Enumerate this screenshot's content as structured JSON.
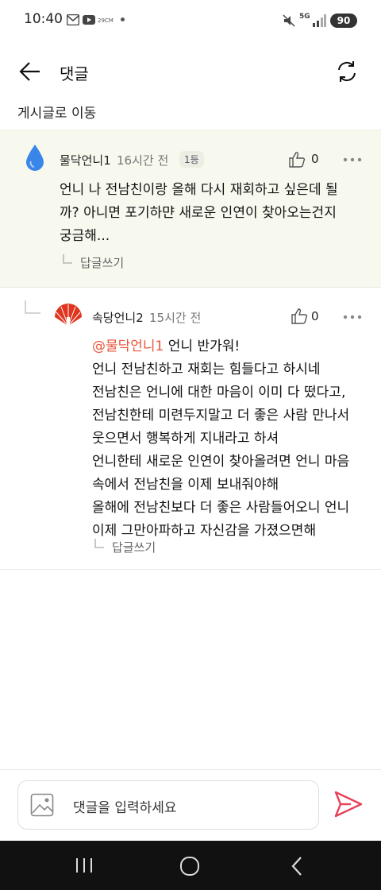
{
  "status_bar": {
    "time": "10:40",
    "mini_label": "29CM",
    "network": "5G",
    "battery": "90"
  },
  "header": {
    "title": "댓글",
    "back_icon": "arrow-left-icon",
    "refresh_icon": "refresh-icon"
  },
  "goto_post": "게시글로 이동",
  "comments": [
    {
      "author": "물닥언니1",
      "time": "16시간 전",
      "badge": "1등",
      "likes": "0",
      "text_lines": [
        "언니 나 전남친이랑 올해 다시 재회하고 싶은데 될",
        "까? 아니면 포기하먄 새로운 인연이 찾아오는건지",
        "궁금해..."
      ],
      "reply_label": "답글쓰기"
    },
    {
      "author": "속당언니2",
      "time": "15시간 전",
      "likes": "0",
      "mention": "@물닥언니1",
      "first_line_rest": " 언니 반가워!",
      "text_lines": [
        "언니 전남친하고 재회는 힘들다고 하시네",
        "전남친은 언니에 대한 마음이 이미 다 떴다고,",
        "전남친한테 미련두지말고 더 좋은 사람 만나서",
        "웃으면서 행복하게 지내라고 하셔",
        "언니한테 새로운 인연이 찾아올려면 언니 마음",
        "속에서 전남친을 이제 보내줘야해",
        "올해에 전남친보다 더 좋은 사람들어오니 언니",
        "이제 그만아파하고 자신감을 가졌으면해"
      ],
      "reply_label": "답글쓰기"
    }
  ],
  "input": {
    "placeholder": "댓글을 입력하세요"
  },
  "colors": {
    "mention": "#e8563a",
    "send": "#e8405a",
    "highlight_bg": "#f7f9ee",
    "water_drop": "#3a86e8",
    "fan": "#e0351f"
  }
}
